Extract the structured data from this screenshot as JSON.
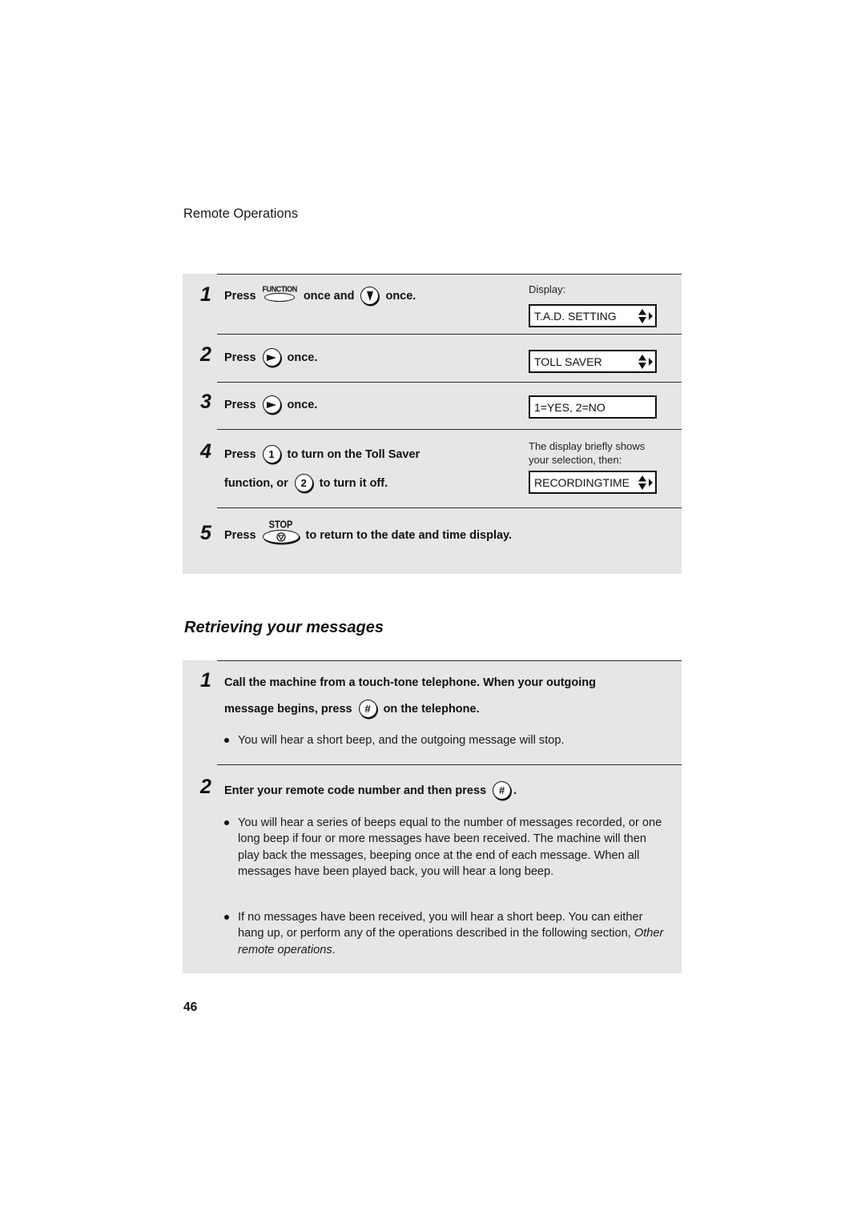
{
  "header": {
    "running_head": "Remote Operations"
  },
  "toll_saver_steps": {
    "display_label": "Display:",
    "steps": [
      {
        "number": "1",
        "parts": [
          "Press",
          "once and",
          "once."
        ],
        "key1": {
          "name": "FUNCTION key",
          "label": "FUNCTION"
        },
        "key2": {
          "name": "down arrow key",
          "icon": "down-arrow"
        }
      },
      {
        "number": "2",
        "parts": [
          "Press",
          "once."
        ],
        "key": {
          "name": "right arrow key",
          "icon": "right-arrow"
        }
      },
      {
        "number": "3",
        "parts": [
          "Press",
          "once."
        ],
        "key": {
          "name": "right arrow key",
          "icon": "right-arrow"
        }
      },
      {
        "number": "4",
        "line1": [
          "Press",
          "to turn on the Toll Saver"
        ],
        "line2": [
          "function, or",
          "to turn it off."
        ],
        "key1": {
          "label": "1"
        },
        "key2": {
          "label": "2"
        }
      },
      {
        "number": "5",
        "parts": [
          "Press",
          "to return to the date and time display."
        ],
        "key": {
          "label": "STOP",
          "icon": "stop"
        }
      }
    ],
    "displays": [
      {
        "text": "T.A.D. SETTING",
        "arrows": true
      },
      {
        "text": "TOLL SAVER",
        "arrows": true
      },
      {
        "text": "1=YES, 2=NO",
        "arrows": false
      },
      {
        "text": "RECORDINGTIME",
        "arrows": true
      }
    ],
    "display_note": [
      "The display briefly shows",
      "your selection, then:"
    ]
  },
  "retrieving": {
    "title": "Retrieving your messages",
    "steps": [
      {
        "number": "1",
        "line1": "Call the machine from a touch-tone telephone. When your outgoing",
        "line2": [
          "message begins, press",
          "on the telephone."
        ],
        "key": {
          "label": "#"
        },
        "bullets": [
          "You will hear a short beep, and the outgoing message will stop."
        ]
      },
      {
        "number": "2",
        "line": [
          "Enter your remote code number and then press",
          "."
        ],
        "key": {
          "label": "#"
        },
        "bullets": [
          "You will hear a series of beeps equal to the number of messages recorded, or one long beep if four or more messages have been received. The machine will then play back the messages, beeping once at the end of each message. When all messages have been played back, you will hear a long beep.",
          {
            "text": "If no messages have been received, you will hear a short beep. You can either hang up, or perform any of the operations described in the following section, ",
            "italic": "Other remote operations",
            "end": "."
          }
        ]
      }
    ]
  },
  "footer": {
    "page_number": "46"
  }
}
